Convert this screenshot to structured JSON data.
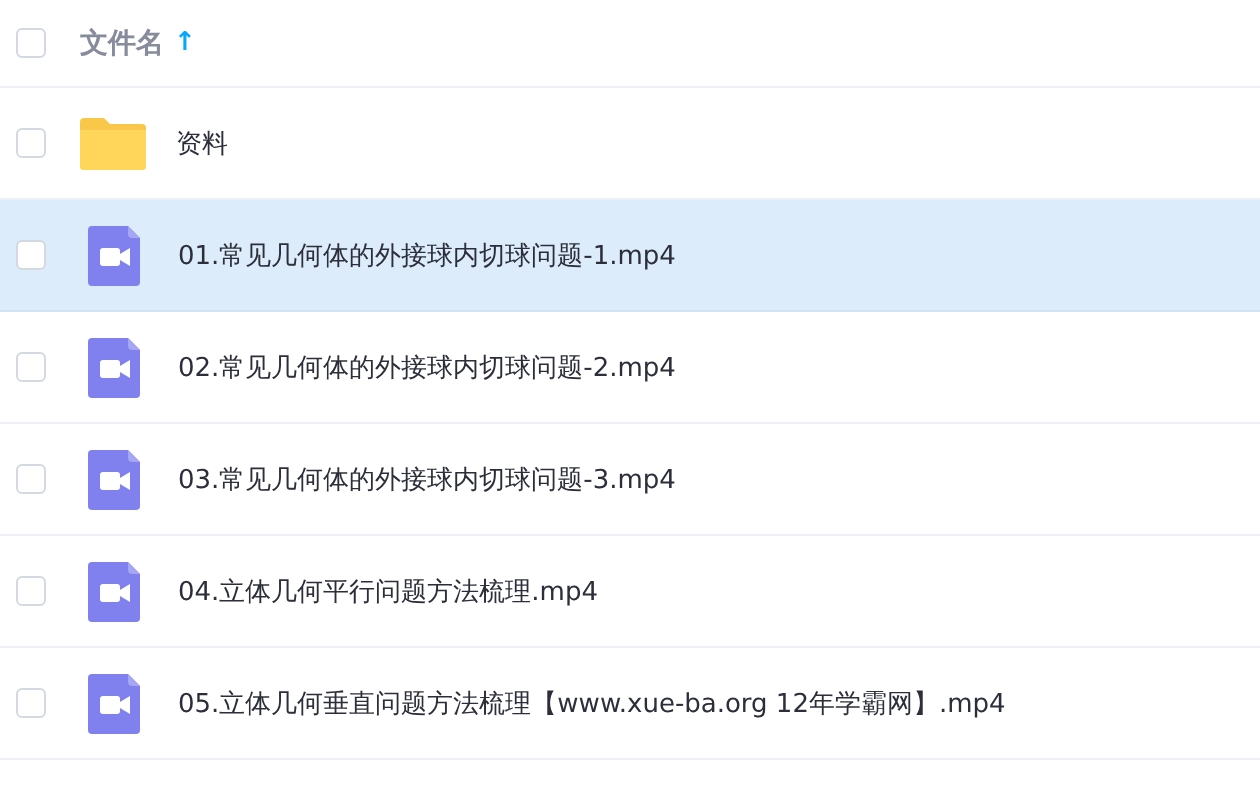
{
  "header": {
    "checked": false,
    "label": "文件名",
    "sort_arrow": "↑"
  },
  "files": [
    {
      "kind": "folder",
      "name": "资料",
      "checked": false,
      "highlighted": false
    },
    {
      "kind": "video",
      "name": "01.常见几何体的外接球内切球问题-1.mp4",
      "checked": false,
      "highlighted": true
    },
    {
      "kind": "video",
      "name": "02.常见几何体的外接球内切球问题-2.mp4",
      "checked": false,
      "highlighted": false
    },
    {
      "kind": "video",
      "name": "03.常见几何体的外接球内切球问题-3.mp4",
      "checked": false,
      "highlighted": false
    },
    {
      "kind": "video",
      "name": "04.立体几何平行问题方法梳理.mp4",
      "checked": false,
      "highlighted": false
    },
    {
      "kind": "video",
      "name": "05.立体几何垂直问题方法梳理【www.xue-ba.org 12年学霸网】.mp4",
      "checked": false,
      "highlighted": false
    }
  ]
}
